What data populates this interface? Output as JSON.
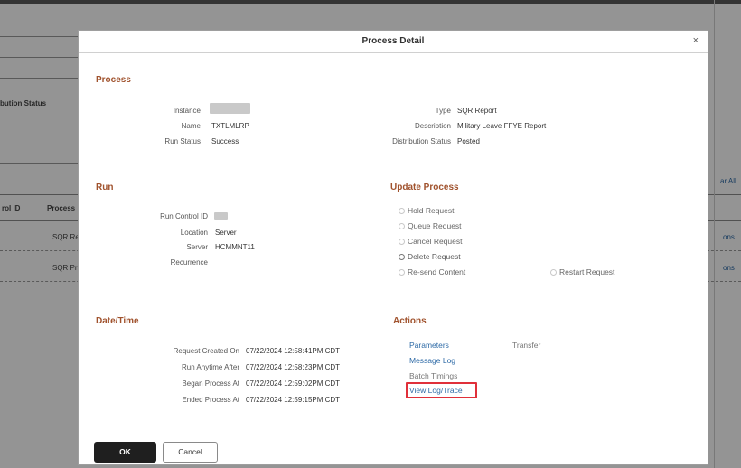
{
  "background": {
    "distribution_status_label": "bution Status",
    "clear_all_label": "ar All",
    "col_control_id": "rol ID",
    "col_process": "Process",
    "rows": [
      {
        "process_type": "SQR Re",
        "action": "ons"
      },
      {
        "process_type": "SQR Pr",
        "action": "ons"
      }
    ]
  },
  "modal": {
    "title": "Process Detail",
    "close_glyph": "×",
    "process": {
      "section_title": "Process",
      "instance_label": "Instance",
      "name_label": "Name",
      "name_value": "TXTLMLRP",
      "run_status_label": "Run Status",
      "run_status_value": "Success",
      "type_label": "Type",
      "type_value": "SQR Report",
      "description_label": "Description",
      "description_value": "Military Leave FFYE Report",
      "distribution_status_label": "Distribution Status",
      "distribution_status_value": "Posted"
    },
    "run": {
      "section_title": "Run",
      "run_control_id_label": "Run Control ID",
      "location_label": "Location",
      "location_value": "Server",
      "server_label": "Server",
      "server_value": "HCMMNT11",
      "recurrence_label": "Recurrence"
    },
    "update_process": {
      "section_title": "Update Process",
      "options": [
        "Hold Request",
        "Queue Request",
        "Cancel Request",
        "Delete Request",
        "Re-send Content",
        "Restart Request"
      ]
    },
    "datetime": {
      "section_title": "Date/Time",
      "request_created_label": "Request Created On",
      "request_created_value": "07/22/2024 12:58:41PM CDT",
      "run_anytime_label": "Run Anytime After",
      "run_anytime_value": "07/22/2024 12:58:23PM CDT",
      "began_label": "Began Process At",
      "began_value": "07/22/2024 12:59:02PM CDT",
      "ended_label": "Ended Process At",
      "ended_value": "07/22/2024 12:59:15PM CDT"
    },
    "actions": {
      "section_title": "Actions",
      "parameters": "Parameters",
      "transfer": "Transfer",
      "message_log": "Message Log",
      "batch_timings": "Batch Timings",
      "view_log_trace": "View Log/Trace"
    },
    "buttons": {
      "ok": "OK",
      "cancel": "Cancel"
    }
  },
  "colors": {
    "section_title": "#a0522d",
    "link": "#2d6aa6",
    "highlight": "#e0303a",
    "ok_button": "#1f1f1f"
  }
}
